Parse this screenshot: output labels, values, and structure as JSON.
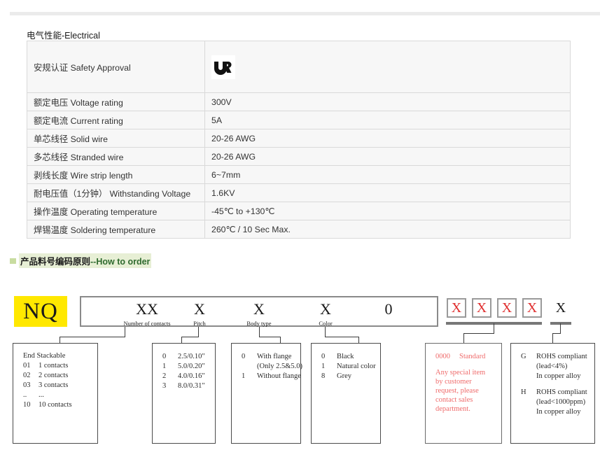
{
  "electrical": {
    "title": "电气性能-Electrical",
    "rows": [
      {
        "label": "安规认证 Safety Approval",
        "value": "",
        "icon": "ul-safety-mark"
      },
      {
        "label": "额定电压 Voltage rating",
        "value": "300V"
      },
      {
        "label": "额定电流 Current rating",
        "value": "5A"
      },
      {
        "label": "单芯线径 Solid wire",
        "value": "20-26 AWG"
      },
      {
        "label": "多芯线径 Stranded wire",
        "value": "20-26 AWG"
      },
      {
        "label": "剥线长度 Wire strip length",
        "value": "6~7mm"
      },
      {
        "label": "耐电压值（1分钟） Withstanding Voltage",
        "value": "1.6KV"
      },
      {
        "label": "操作温度 Operating temperature",
        "value": "-45℃ to +130℃"
      },
      {
        "label": "焊锡温度 Soldering temperature",
        "value": "260℃ / 10 Sec Max."
      }
    ]
  },
  "order": {
    "header_cn": "产品料号编码原则",
    "header_en": "--How to order",
    "prefix": "NQ",
    "slots": [
      {
        "char": "XX",
        "sub": "Number of contacts"
      },
      {
        "char": "X",
        "sub": "Pitch"
      },
      {
        "char": "X",
        "sub": "Body type"
      },
      {
        "char": "X",
        "sub": "Color"
      },
      {
        "char": "0",
        "sub": ""
      }
    ],
    "suffix_boxes": [
      "X",
      "X",
      "X",
      "X"
    ],
    "final_char": "X",
    "legends": {
      "contacts": {
        "title": "End Stackable",
        "rows": [
          {
            "code": "01",
            "desc": "1 contacts"
          },
          {
            "code": "02",
            "desc": "2 contacts"
          },
          {
            "code": "03",
            "desc": "3 contacts"
          },
          {
            "code": "..",
            "desc": "..."
          },
          {
            "code": "10",
            "desc": "10 contacts"
          }
        ]
      },
      "pitch": {
        "rows": [
          {
            "code": "0",
            "desc": "2.5/0.10″"
          },
          {
            "code": "1",
            "desc": "5.0/0.20″"
          },
          {
            "code": "2",
            "desc": "4.0/0.16″"
          },
          {
            "code": "3",
            "desc": "8.0/0.31″"
          }
        ]
      },
      "body": {
        "rows": [
          {
            "code": "0",
            "desc": "With flange"
          },
          {
            "code": "",
            "desc": "(Only 2.5&5.0)"
          },
          {
            "code": "1",
            "desc": "Without flange"
          }
        ]
      },
      "color": {
        "rows": [
          {
            "code": "0",
            "desc": "Black"
          },
          {
            "code": "1",
            "desc": "Natural color"
          },
          {
            "code": "8",
            "desc": "Grey"
          }
        ]
      },
      "special": {
        "code": "0000",
        "code_desc": "Standard",
        "note": "Any special item by customer request, please contact sales department."
      },
      "rohs": {
        "entries": [
          {
            "code": "G",
            "l1": "ROHS compliant",
            "l2": "(lead<4%)",
            "l3": "In copper alloy"
          },
          {
            "code": "H",
            "l1": "ROHS compliant",
            "l2": "(lead<1000ppm)",
            "l3": "In copper alloy"
          }
        ]
      }
    }
  }
}
